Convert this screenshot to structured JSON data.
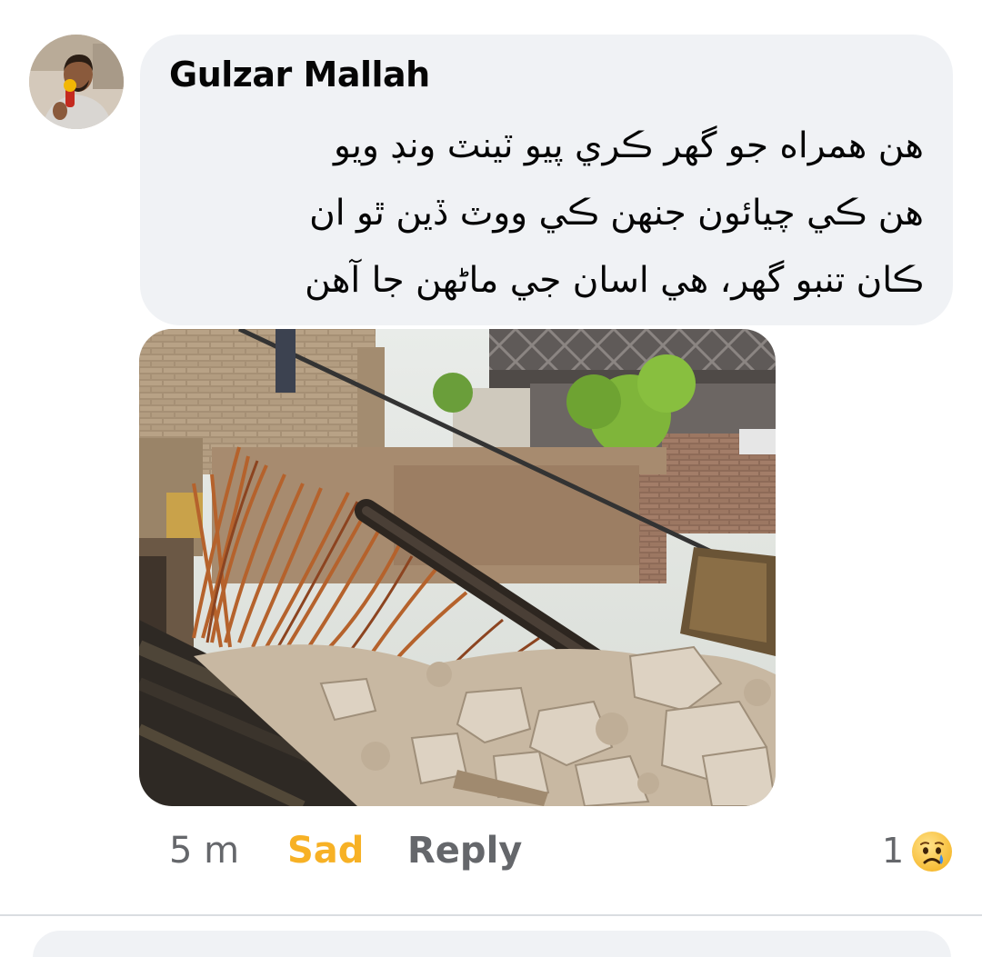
{
  "comment": {
    "author": "Gulzar Mallah",
    "text_lines": [
      "هن همراه جو گهر ڪري پيو ٽينٽ ونڊ ويو",
      "هن ڪي چيائون جنهن ڪي ووٽ ڏين ٿو ان",
      "ڪان تنبو گهر، هي اسان جي ماڻهن جا آهن"
    ],
    "avatar_icon": "profile-photo",
    "photo_icon": "collapsed-house-photo"
  },
  "actions": {
    "time": "5 m",
    "reaction_label": "Sad",
    "reply_label": "Reply",
    "reaction_count": "1",
    "reaction_icon": "sad-face-emoji",
    "reaction_color": "#f7b125"
  }
}
